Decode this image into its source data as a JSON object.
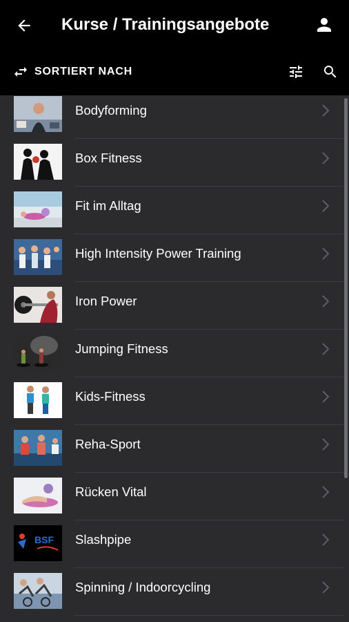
{
  "header": {
    "title": "Kurse / Trainingsangebote",
    "back_icon": "arrow-left-icon",
    "profile_icon": "person-icon",
    "sort_label": "SORTIERT NACH",
    "sort_icon": "swap-arrows-icon",
    "filter_icon": "sliders-icon",
    "search_icon": "search-icon"
  },
  "courses": [
    {
      "label": "Bodyforming"
    },
    {
      "label": "Box Fitness"
    },
    {
      "label": "Fit im Alltag"
    },
    {
      "label": "High Intensity Power Training"
    },
    {
      "label": "Iron Power"
    },
    {
      "label": "Jumping Fitness"
    },
    {
      "label": "Kids-Fitness"
    },
    {
      "label": "Reha-Sport"
    },
    {
      "label": "Rücken Vital"
    },
    {
      "label": "Slashpipe"
    },
    {
      "label": "Spinning / Indoorcycling"
    }
  ],
  "logo_text": "BSF",
  "colors": {
    "appbar": "#000000",
    "background": "#2b2b2e",
    "separator": "#3e3e42",
    "chevron": "#5f5f63"
  }
}
